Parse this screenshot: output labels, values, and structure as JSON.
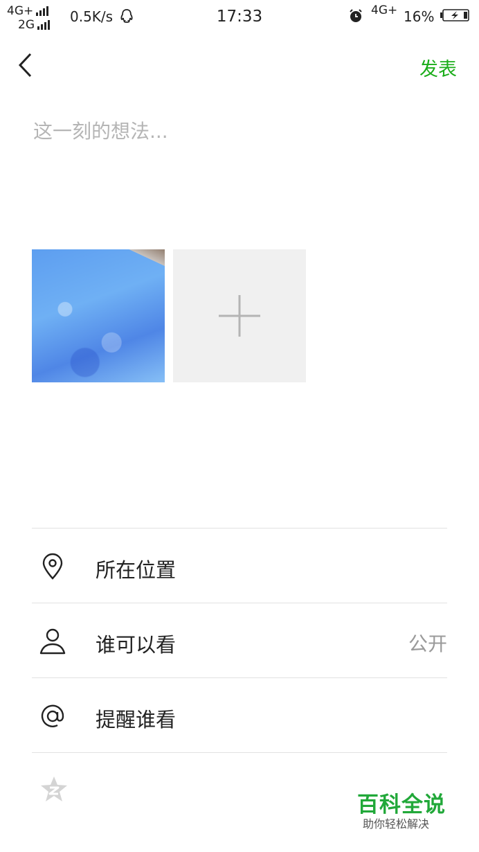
{
  "status_bar": {
    "network_top": "4G+",
    "network_bottom": "2G",
    "speed": "0.5K/s",
    "time": "17:33",
    "network_right": "4G+",
    "battery_percent": "16%",
    "battery_level": 0.16,
    "icons": [
      "qq-icon",
      "alarm-icon",
      "charging-battery-icon"
    ]
  },
  "nav": {
    "back_icon": "chevron-left-icon",
    "publish_label": "发表",
    "publish_color": "#1aad19"
  },
  "composer": {
    "placeholder": "这一刻的想法...",
    "value": ""
  },
  "photos": {
    "add_icon": "plus-icon"
  },
  "options": [
    {
      "icon": "location-pin-icon",
      "label": "所在位置",
      "value": ""
    },
    {
      "icon": "person-icon",
      "label": "谁可以看",
      "value": "公开"
    },
    {
      "icon": "at-sign-icon",
      "label": "提醒谁看",
      "value": ""
    }
  ],
  "share": {
    "icon": "qzone-star-icon"
  },
  "watermark": {
    "title": "百科全说",
    "subtitle": "助你轻松解决",
    "color": "#21a839"
  }
}
